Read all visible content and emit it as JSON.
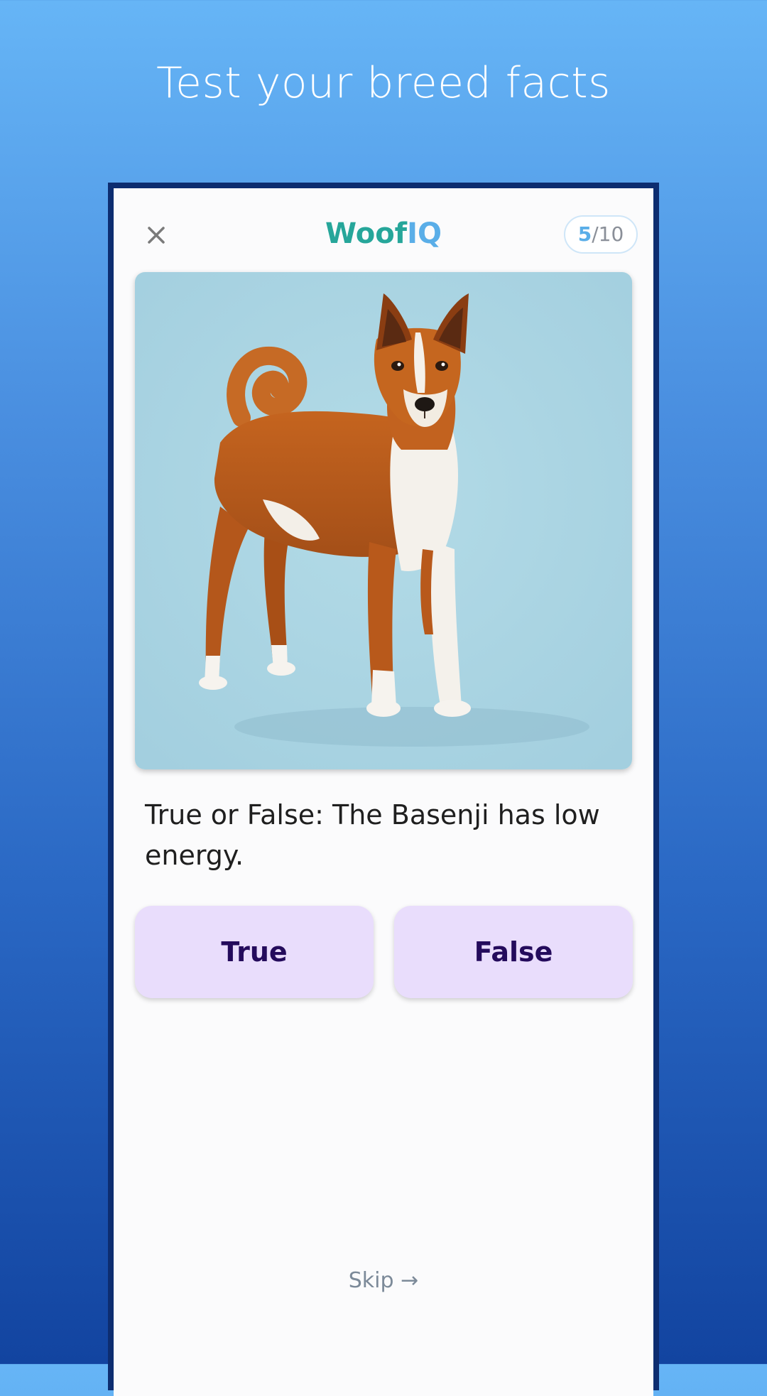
{
  "promo": {
    "headline": "Test your breed facts"
  },
  "app": {
    "title_part1": "Woof",
    "title_part2": "IQ",
    "close_icon": "close-icon"
  },
  "progress": {
    "current": "5",
    "separator": "/",
    "total": "10"
  },
  "question": {
    "image": "basenji-photo",
    "text": "True or False: The Basenji has low energy."
  },
  "answers": {
    "true_label": "True",
    "false_label": "False"
  },
  "skip": {
    "label": "Skip →"
  },
  "colors": {
    "brand_green": "#26a69a",
    "brand_blue": "#5aaee8",
    "answer_bg": "#e9ddfc",
    "answer_text": "#240b5c",
    "device_frame": "#0d2d70"
  }
}
